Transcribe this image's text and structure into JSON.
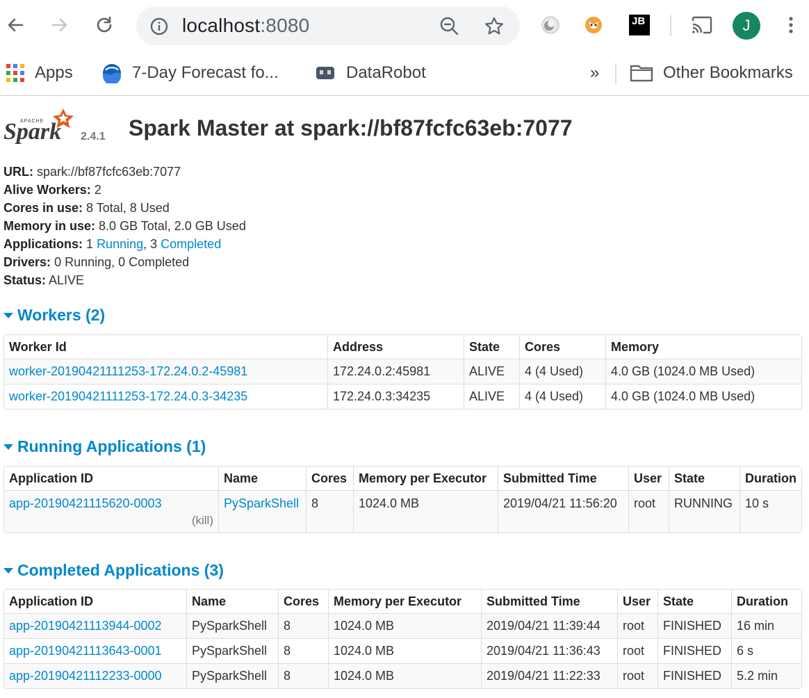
{
  "browser": {
    "url_host": "localhost",
    "url_port": ":8080",
    "avatar_letter": "J",
    "bookmarks": [
      {
        "label": "Apps"
      },
      {
        "label": "7-Day Forecast fo..."
      },
      {
        "label": "DataRobot"
      }
    ],
    "overflow_label": "»",
    "other_bookmarks": "Other Bookmarks",
    "ext_jb": "JB"
  },
  "page": {
    "logo_small": "APACHE",
    "logo_word": "Spark",
    "version": "2.4.1",
    "title": "Spark Master at spark://bf87fcfc63eb:7077"
  },
  "info": {
    "url_label": "URL:",
    "url_value": "spark://bf87fcfc63eb:7077",
    "workers_label": "Alive Workers:",
    "workers_value": "2",
    "cores_label": "Cores in use:",
    "cores_value": "8 Total, 8 Used",
    "memory_label": "Memory in use:",
    "memory_value": "8.0 GB Total, 2.0 GB Used",
    "apps_label": "Applications:",
    "apps_running_count": "1",
    "apps_running_link": "Running",
    "apps_sep": ", 3",
    "apps_completed_link": "Completed",
    "drivers_label": "Drivers:",
    "drivers_value": "0 Running, 0 Completed",
    "status_label": "Status:",
    "status_value": "ALIVE"
  },
  "workers": {
    "title": "Workers (2)",
    "headers": [
      "Worker Id",
      "Address",
      "State",
      "Cores",
      "Memory"
    ],
    "rows": [
      [
        "worker-20190421111253-172.24.0.2-45981",
        "172.24.0.2:45981",
        "ALIVE",
        "4 (4 Used)",
        "4.0 GB (1024.0 MB Used)"
      ],
      [
        "worker-20190421111253-172.24.0.3-34235",
        "172.24.0.3:34235",
        "ALIVE",
        "4 (4 Used)",
        "4.0 GB (1024.0 MB Used)"
      ]
    ]
  },
  "running": {
    "title": "Running Applications (1)",
    "headers": [
      "Application ID",
      "Name",
      "Cores",
      "Memory per Executor",
      "Submitted Time",
      "User",
      "State",
      "Duration"
    ],
    "rows": [
      [
        "app-20190421115620-0003",
        "PySparkShell",
        "8",
        "1024.0 MB",
        "2019/04/21 11:56:20",
        "root",
        "RUNNING",
        "10 s"
      ]
    ],
    "kill_label": "(kill)"
  },
  "completed": {
    "title": "Completed Applications (3)",
    "headers": [
      "Application ID",
      "Name",
      "Cores",
      "Memory per Executor",
      "Submitted Time",
      "User",
      "State",
      "Duration"
    ],
    "rows": [
      [
        "app-20190421113944-0002",
        "PySparkShell",
        "8",
        "1024.0 MB",
        "2019/04/21 11:39:44",
        "root",
        "FINISHED",
        "16 min"
      ],
      [
        "app-20190421113643-0001",
        "PySparkShell",
        "8",
        "1024.0 MB",
        "2019/04/21 11:36:43",
        "root",
        "FINISHED",
        "6 s"
      ],
      [
        "app-20190421112233-0000",
        "PySparkShell",
        "8",
        "1024.0 MB",
        "2019/04/21 11:22:33",
        "root",
        "FINISHED",
        "5.2 min"
      ]
    ]
  }
}
